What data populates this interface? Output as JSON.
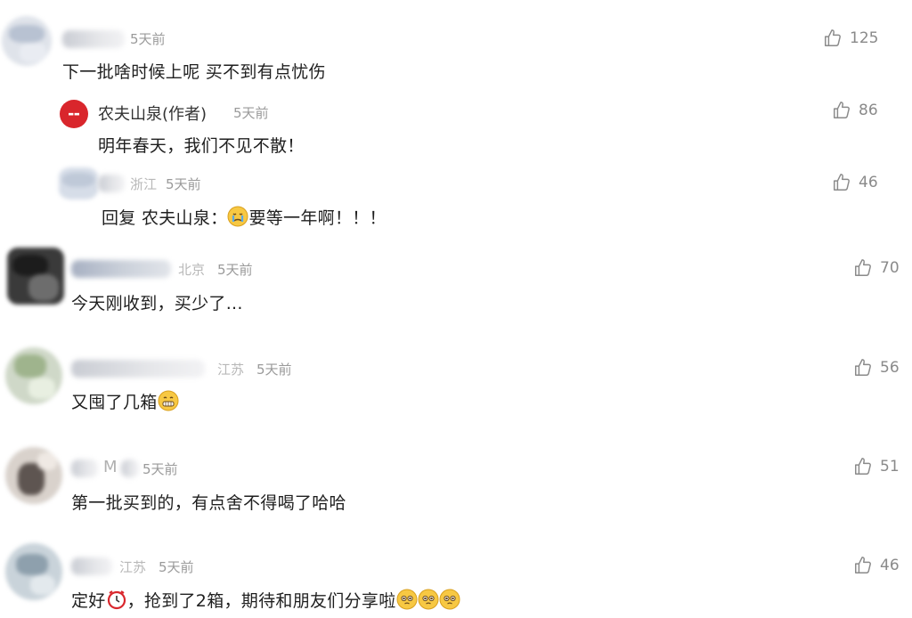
{
  "comments": [
    {
      "location": "",
      "time": "5天前",
      "text": "下一批啥时候上呢 买不到有点忧伤",
      "likes": "125"
    },
    {
      "author": "农夫山泉(作者)",
      "time": "5天前",
      "text": "明年春天，我们不见不散！",
      "likes": "86"
    },
    {
      "location": "浙江",
      "time": "5天前",
      "text_prefix": "回复 农夫山泉：",
      "text_suffix": "要等一年啊！！！",
      "likes": "46",
      "emoji": "crying-face"
    },
    {
      "location": "北京",
      "time": "5天前",
      "text": "今天刚收到，买少了...",
      "likes": "70"
    },
    {
      "location": "江苏",
      "time": "5天前",
      "text": "又囤了几箱",
      "likes": "56",
      "emoji": "grinning-face"
    },
    {
      "name_visible": "M",
      "time": "5天前",
      "text": "第一批买到的，有点舍不得喝了哈哈",
      "likes": "51"
    },
    {
      "location": "江苏",
      "time": "5天前",
      "text_prefix": "定好",
      "text_suffix": "，抢到了2箱，期待和朋友们分享啦",
      "likes": "46",
      "emoji": "alarm-clock"
    }
  ],
  "icons": {
    "like": "thumbs-up-icon"
  },
  "colors": {
    "meta": "#9a9a9a",
    "brand": "#d9262c"
  }
}
